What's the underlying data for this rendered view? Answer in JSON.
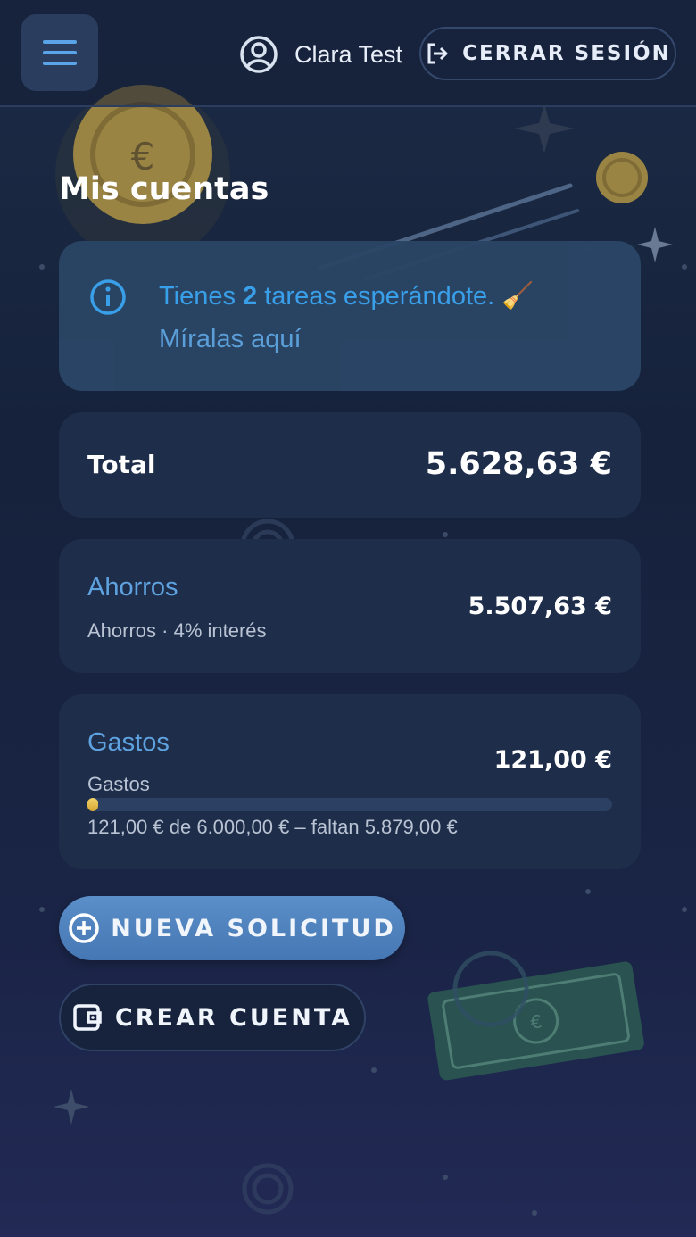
{
  "header": {
    "user_name": "Clara Test",
    "logout_label": "CERRAR SESIÓN",
    "menu_icon": "hamburger-menu-icon",
    "user_icon": "user-circle-icon",
    "logout_icon": "logout-icon"
  },
  "page": {
    "title": "Mis cuentas"
  },
  "notice": {
    "prefix": "Tienes ",
    "count": "2",
    "suffix": " tareas esperándote. 🧹",
    "link": "Míralas aquí",
    "icon": "info-icon"
  },
  "total": {
    "label": "Total",
    "amount": "5.628,63 €"
  },
  "accounts": [
    {
      "name": "Ahorros",
      "subtitle": "Ahorros · 4% interés",
      "amount": "5.507,63 €"
    },
    {
      "name": "Gastos",
      "subtitle": "Gastos",
      "amount": "121,00 €",
      "progress_fraction": 0.0202,
      "progress_text": "121,00 € de 6.000,00 € – faltan 5.879,00 €"
    }
  ],
  "actions": {
    "new_request_label": "NUEVA SOLICITUD",
    "new_request_icon": "plus-circle-icon",
    "create_account_label": "CREAR CUENTA",
    "create_account_icon": "wallet-icon"
  },
  "colors": {
    "accent_blue": "#5ea3e0",
    "info_text": "#3ba3ee",
    "progress_fill": "#e3b94a",
    "card_bg": "#1e2d4a"
  }
}
